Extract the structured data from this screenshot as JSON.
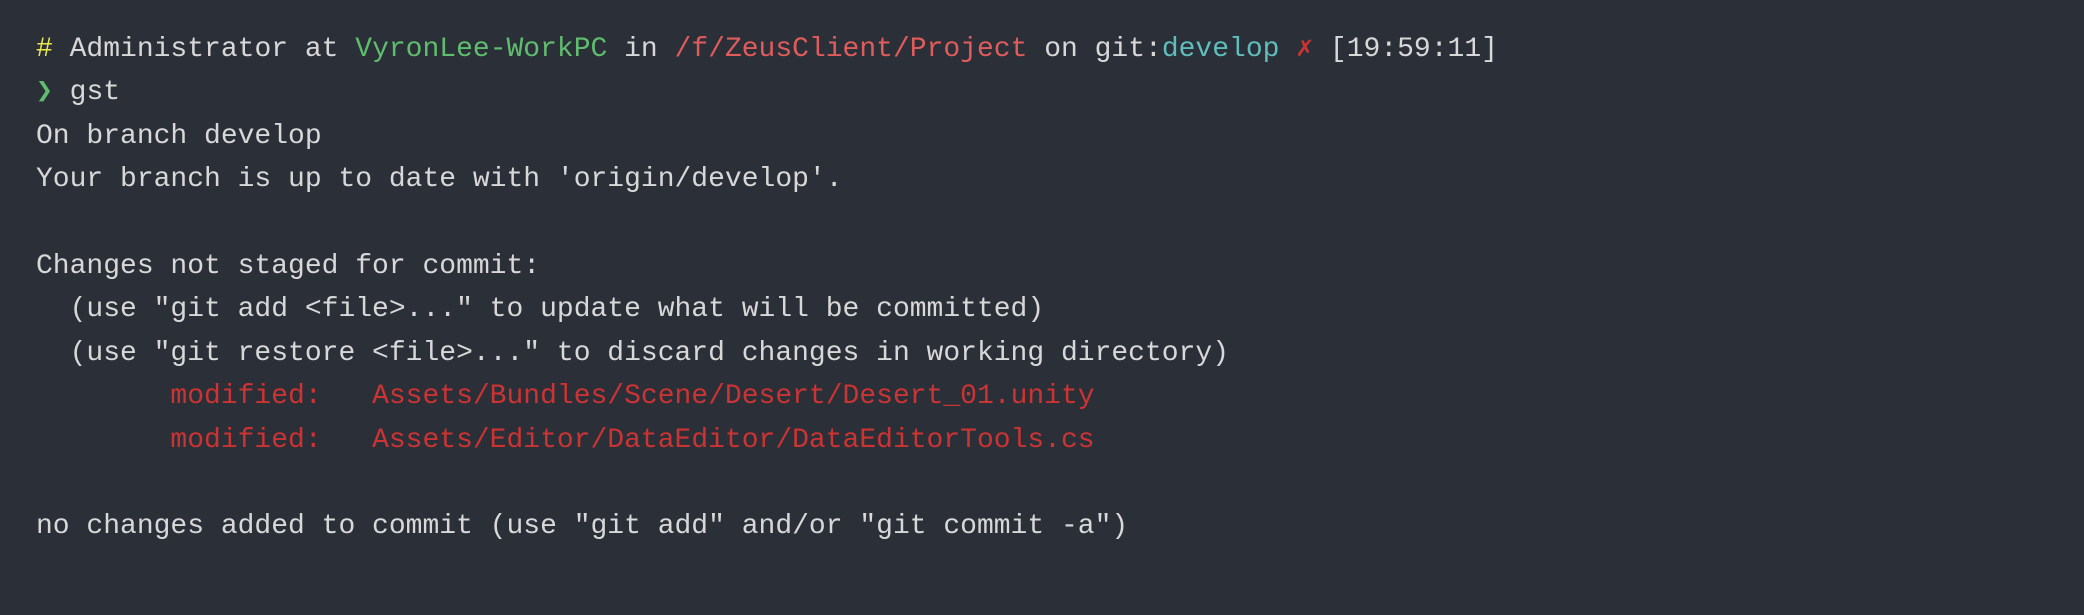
{
  "terminal": {
    "line1": {
      "hash": "# ",
      "user": "Administrator",
      "at": " at ",
      "host": "VyronLee-WorkPC",
      "in": " in ",
      "path": "/f/ZeusClient/Project",
      "on": " on ",
      "git_label": "git:",
      "branch": "develop",
      "cross": " ✗ ",
      "time": "[19:59:11]"
    },
    "line2": {
      "prompt": "❯ ",
      "command": "gst"
    },
    "line3": "On branch develop",
    "line4": "Your branch is up to date with 'origin/develop'.",
    "line5": "",
    "line6": "Changes not staged for commit:",
    "line7": "  (use \"git add <file>...\" to update what will be committed)",
    "line8": "  (use \"git restore <file>...\" to discard changes in working directory)",
    "line9_label": "        modified:   ",
    "line9_file": "Assets/Bundles/Scene/Desert/Desert_01.unity",
    "line10_label": "        modified:   ",
    "line10_file": "Assets/Editor/DataEditor/DataEditorTools.cs",
    "line11": "",
    "line12": "no changes added to commit (use \"git add\" and/or \"git commit -a\")"
  }
}
